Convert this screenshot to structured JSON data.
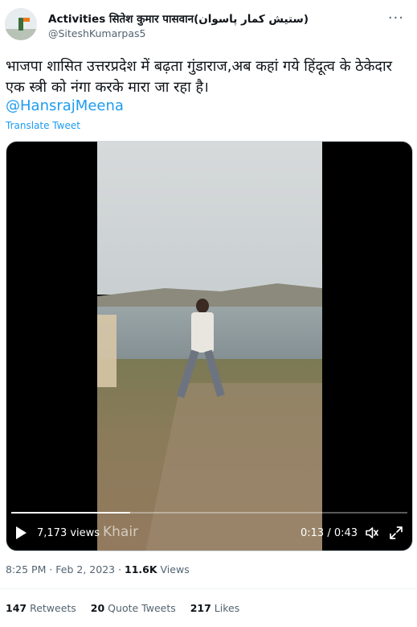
{
  "user": {
    "display_name": "Activities सितेश कुमार पासवान(ستیش کمار پاسوان)",
    "handle": "@SiteshKumarpas5"
  },
  "tweet": {
    "text": "भाजपा शासित उत्तरप्रदेश में बढ़ता गुंडाराज,अब कहां गये हिंदूत्व के ठेकेदार एक स्त्री को नंगा करके मारा जा रहा है।",
    "mention": "@HansrajMeena",
    "translate_label": "Translate Tweet"
  },
  "video": {
    "views": "7,173 views",
    "watermark": "Khair",
    "time": "0:13 / 0:43",
    "progress": 0.3
  },
  "meta": {
    "timestamp": "8:25 PM · Feb 2, 2023 · ",
    "views_count": "11.6K",
    "views_label": " Views"
  },
  "stats": {
    "retweets_count": "147",
    "retweets_label": " Retweets",
    "quote_count": "20",
    "quote_label": " Quote Tweets",
    "likes_count": "217",
    "likes_label": " Likes"
  },
  "icons": [
    "more-icon",
    "play-icon",
    "volume-icon",
    "fullscreen-icon"
  ]
}
